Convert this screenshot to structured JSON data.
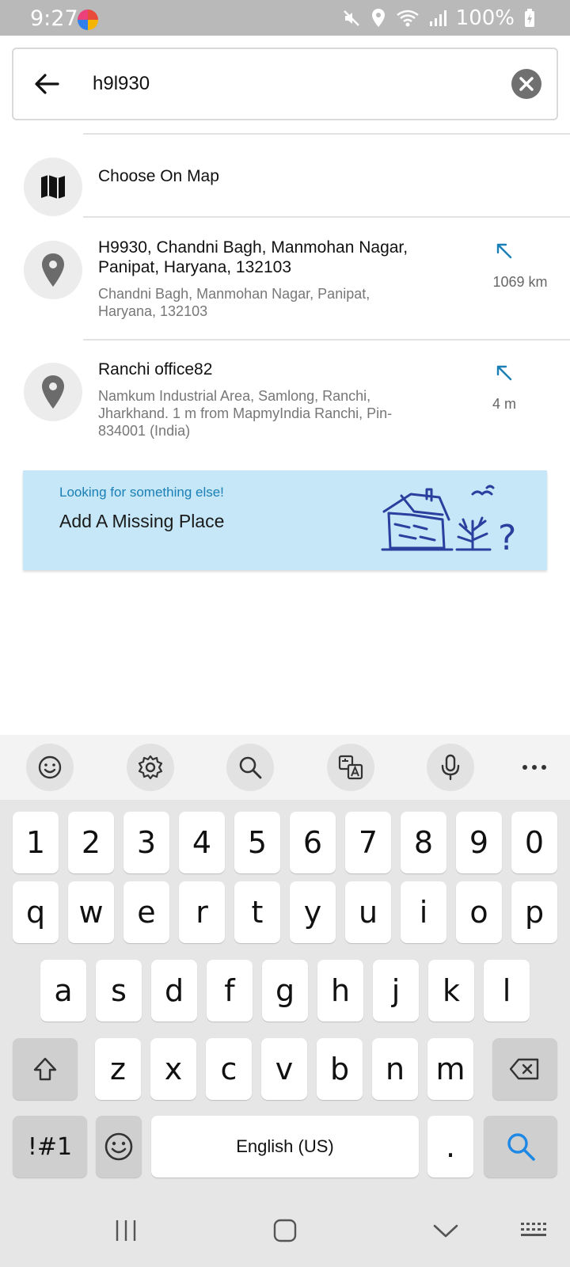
{
  "status_bar": {
    "time": "9:27",
    "battery": "100%",
    "icons": [
      "mute-icon",
      "location-icon",
      "wifi-icon",
      "signal-icon",
      "battery-charging-icon"
    ]
  },
  "search": {
    "value": "h9l930",
    "placeholder": ""
  },
  "list": {
    "choose_on_map": "Choose On Map",
    "results": [
      {
        "title": "H9930, Chandni Bagh, Manmohan Nagar, Panipat, Haryana, 132103",
        "subtitle": "Chandni Bagh, Manmohan Nagar, Panipat, Haryana, 132103",
        "distance": "1069 km"
      },
      {
        "title": "Ranchi office82",
        "subtitle": "Namkum Industrial Area, Samlong, Ranchi, Jharkhand. 1 m from MapmyIndia Ranchi, Pin-834001 (India)",
        "distance": "4 m"
      }
    ]
  },
  "banner": {
    "kicker": "Looking for something else!",
    "title": "Add A Missing Place"
  },
  "keyboard": {
    "toolbar": [
      "emoji-icon",
      "settings-icon",
      "search-icon",
      "translate-icon",
      "mic-icon",
      "more-icon"
    ],
    "row_numbers": [
      "1",
      "2",
      "3",
      "4",
      "5",
      "6",
      "7",
      "8",
      "9",
      "0"
    ],
    "row_q": [
      "q",
      "w",
      "e",
      "r",
      "t",
      "y",
      "u",
      "i",
      "o",
      "p"
    ],
    "row_a": [
      "a",
      "s",
      "d",
      "f",
      "g",
      "h",
      "j",
      "k",
      "l"
    ],
    "row_z": [
      "z",
      "x",
      "c",
      "v",
      "b",
      "n",
      "m"
    ],
    "symbols_label": "!#1",
    "space_label": "English (US)",
    "period": "."
  },
  "colors": {
    "accent": "#1a7fb5",
    "banner_bg": "#c5e7f7",
    "search_key_icon": "#1e88e5"
  }
}
